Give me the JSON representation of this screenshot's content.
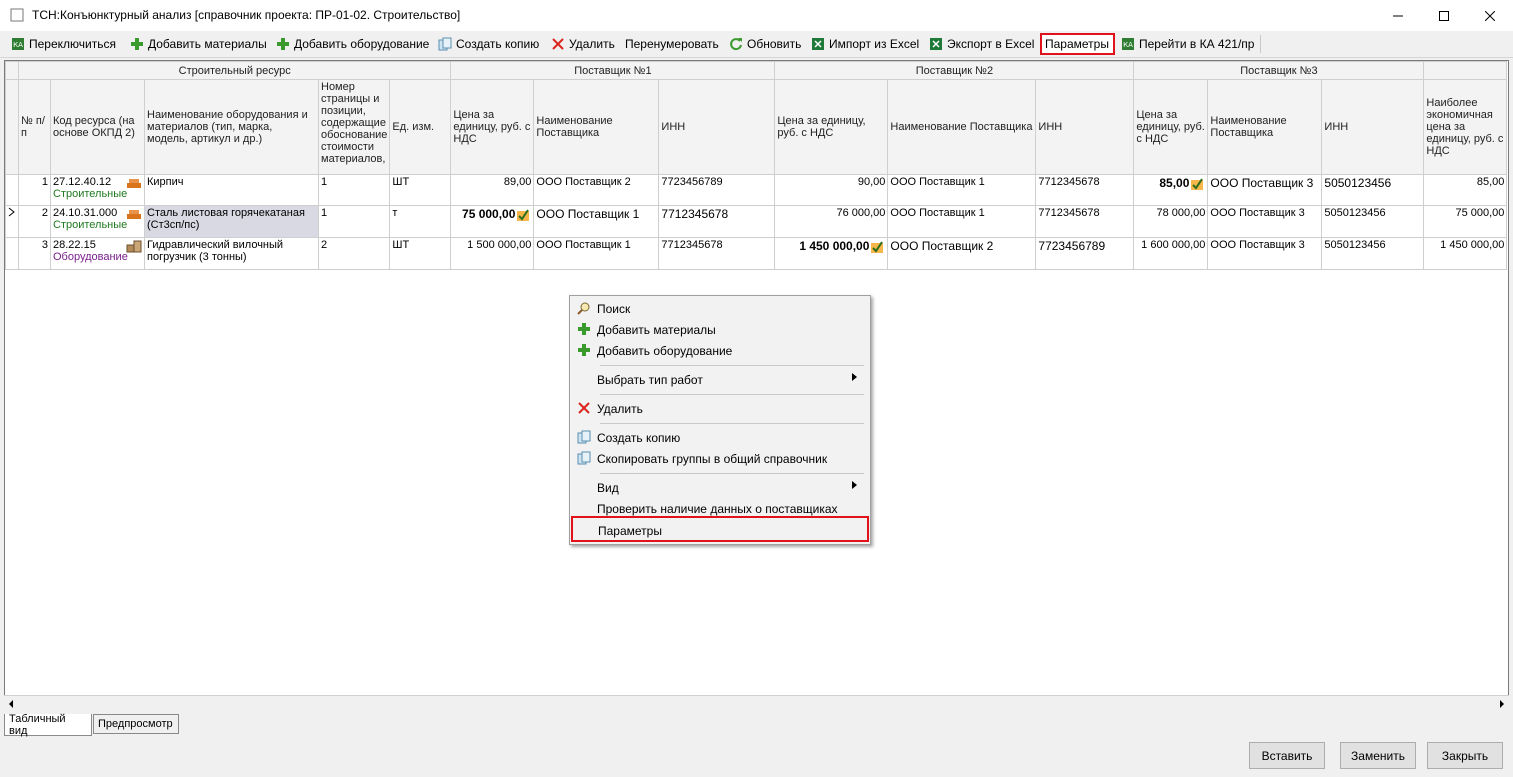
{
  "window": {
    "title": "ТСН:Конъюнктурный анализ [справочник проекта: ПР-01-02. Строительство]",
    "minimize": "—",
    "maximize": "☐",
    "close": "✕"
  },
  "toolbar": {
    "switch": "Переключиться",
    "add_materials": "Добавить материалы",
    "add_equipment": "Добавить оборудование",
    "create_copy": "Создать копию",
    "delete": "Удалить",
    "renumber": "Перенумеровать",
    "refresh": "Обновить",
    "import_excel": "Импорт из Excel",
    "export_excel": "Экспорт в Excel",
    "parameters": "Параметры",
    "goto_ka": "Перейти в КА 421/пр"
  },
  "grid": {
    "groups": {
      "resource": "Строительный ресурс",
      "supplier1": "Поставщик №1",
      "supplier2": "Поставщик №2",
      "supplier3": "Поставщик №3"
    },
    "headers": {
      "num": "№ п/п",
      "code": "Код ресурса (на основе ОКПД 2)",
      "name": "Наименование оборудования и материалов (тип, марка, модель, артикул и др.)",
      "page": "Номер страницы и позиции, содержащие обоснование стоимости материалов,",
      "unit": "Ед. изм.",
      "s1_price": "Цена за единицу, руб. с НДС",
      "s1_name": "Наименование Поставщика",
      "s1_inn": "ИНН",
      "s2_price": "Цена за единицу, руб. с НДС",
      "s2_name": "Наименование Поставщика",
      "s2_inn": "ИНН",
      "s3_price": "Цена за единицу, руб. с НДС",
      "s3_name": "Наименование Поставщика",
      "s3_inn": "ИНН",
      "best": "Наиболее экономичная цена за единицу, руб. с НДС"
    },
    "rows": [
      {
        "num": "1",
        "code": "27.12.40.12",
        "category": "Строительные",
        "name": "Кирпич",
        "page": "1",
        "unit": "ШТ",
        "s1_price": "89,00",
        "s1_name": "ООО Поставщик 2",
        "s1_inn": "7723456789",
        "s2_price": "90,00",
        "s2_name": "ООО Поставщик 1",
        "s2_inn": "7712345678",
        "s3_price": "85,00",
        "s3_name": "ООО Поставщик 3",
        "s3_inn": "5050123456",
        "best": "85,00"
      },
      {
        "num": "2",
        "code": "24.10.31.000",
        "category": "Строительные",
        "name": "Сталь листовая горячекатаная (Ст3сп/пс)",
        "page": "1",
        "unit": "т",
        "s1_price": "75 000,00",
        "s1_name": "ООО Поставщик 1",
        "s1_inn": "7712345678",
        "s2_price": "76 000,00",
        "s2_name": "ООО Поставщик 1",
        "s2_inn": "7712345678",
        "s3_price": "78 000,00",
        "s3_name": "ООО Поставщик 3",
        "s3_inn": "5050123456",
        "best": "75 000,00"
      },
      {
        "num": "3",
        "code": "28.22.15",
        "category": "Оборудование",
        "name": "Гидравлический вилочный погрузчик (3 тонны)",
        "page": "2",
        "unit": "ШТ",
        "s1_price": "1 500 000,00",
        "s1_name": "ООО Поставщик 1",
        "s1_inn": "7712345678",
        "s2_price": "1 450 000,00",
        "s2_name": "ООО Поставщик 2",
        "s2_inn": "7723456789",
        "s3_price": "1 600 000,00",
        "s3_name": "ООО Поставщик 3",
        "s3_inn": "5050123456",
        "best": "1 450 000,00"
      }
    ]
  },
  "context_menu": {
    "search": "Поиск",
    "add_materials": "Добавить материалы",
    "add_equipment": "Добавить оборудование",
    "select_work_type": "Выбрать тип работ",
    "delete": "Удалить",
    "create_copy": "Создать копию",
    "copy_groups": "Скопировать группы в общий справочник",
    "view": "Вид",
    "check_suppliers": "Проверить наличие данных о поставщиках",
    "parameters": "Параметры"
  },
  "tabs": {
    "table_view": "Табличный вид",
    "preview": "Предпросмотр"
  },
  "buttons": {
    "insert": "Вставить",
    "replace": "Заменить",
    "close": "Закрыть"
  },
  "colors": {
    "highlight": "#e0121b",
    "green_icon": "#3a9a2e",
    "delete_red": "#d9251c"
  }
}
